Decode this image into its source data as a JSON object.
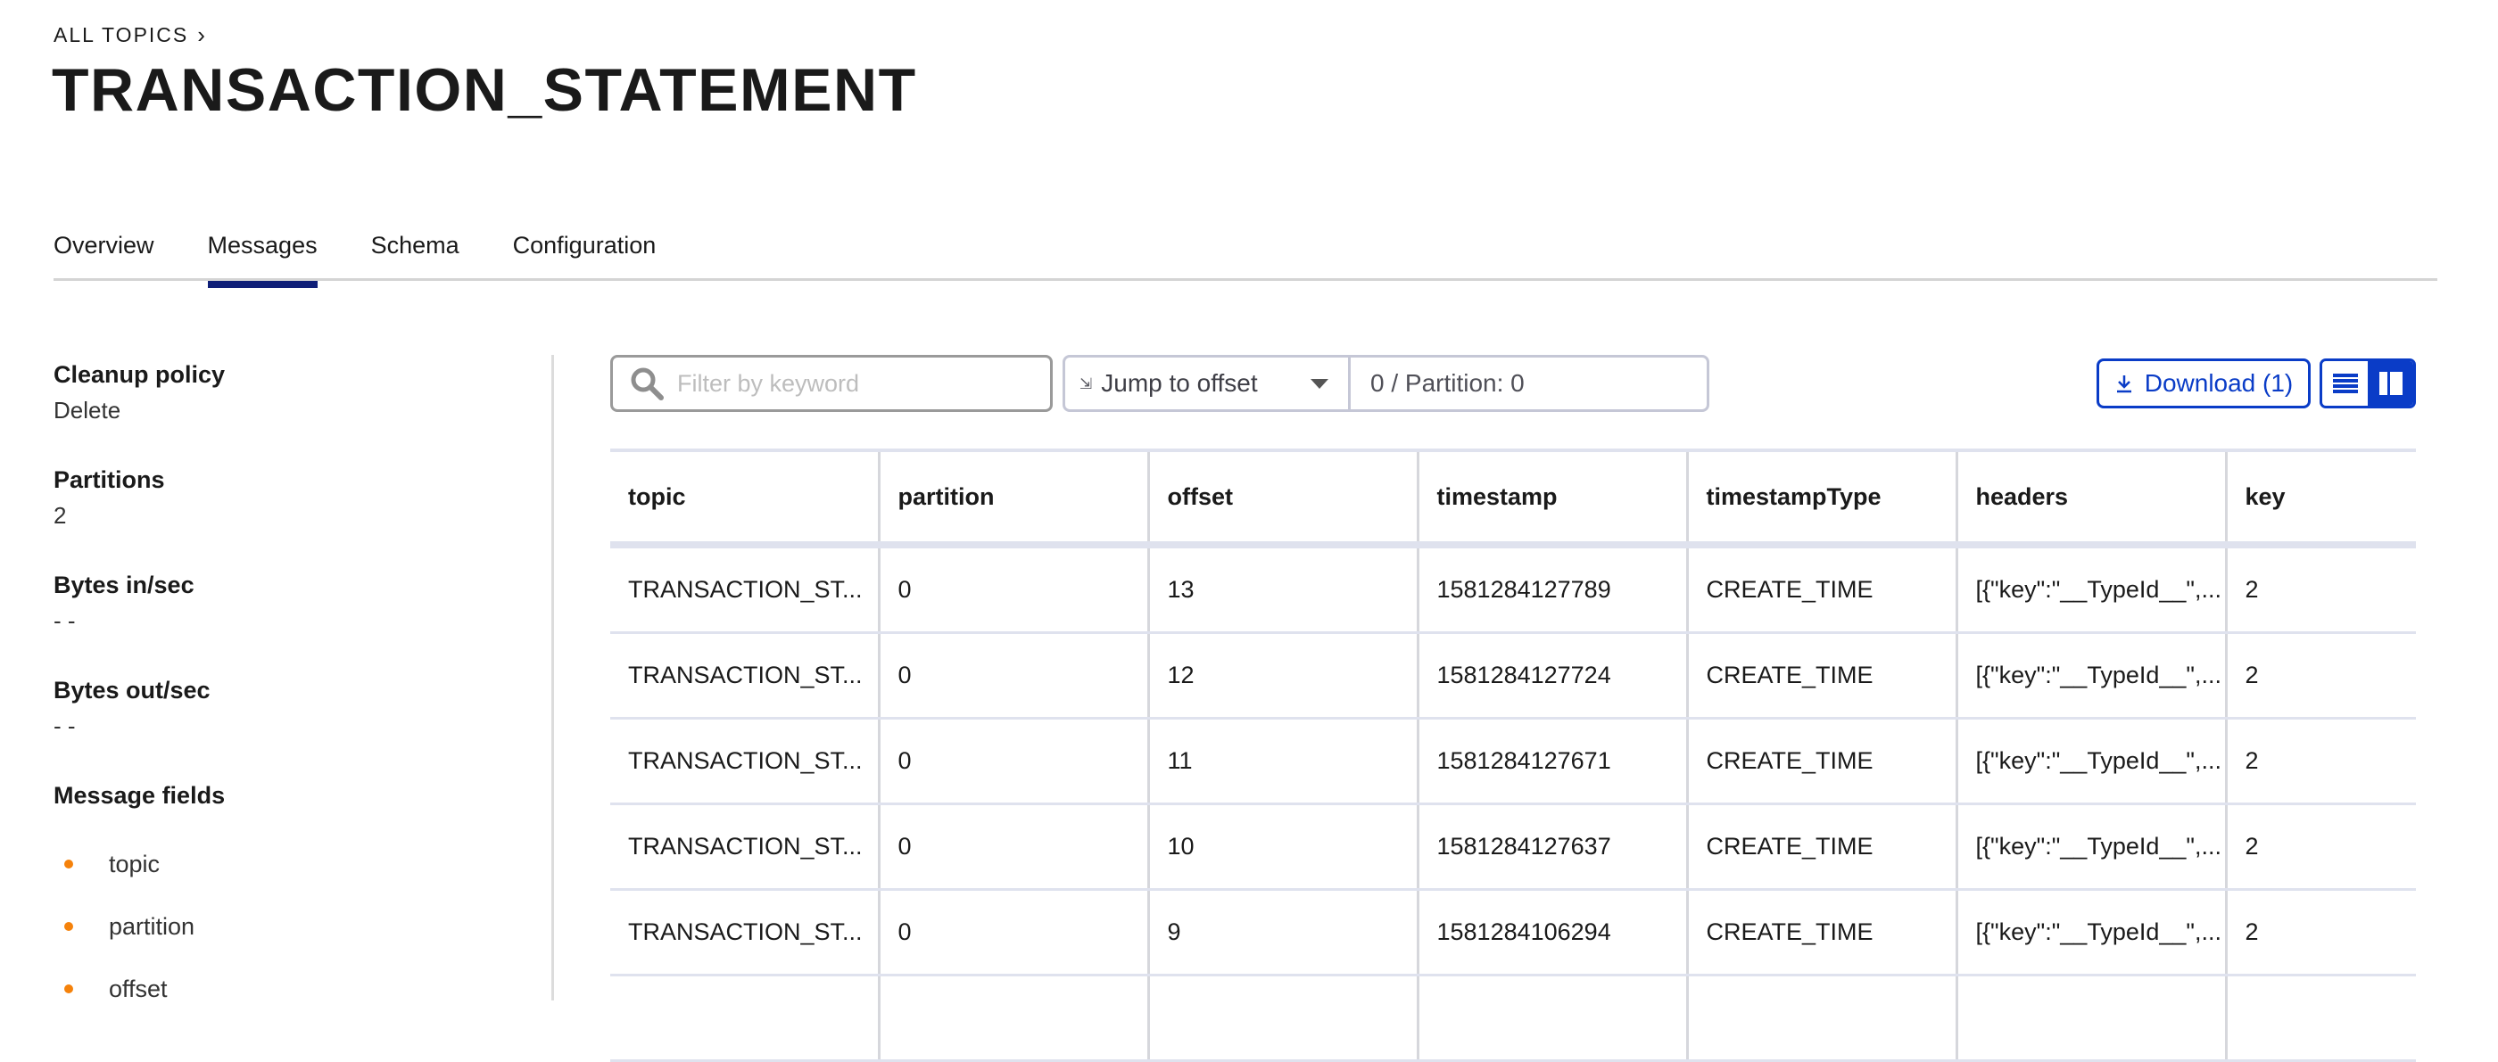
{
  "breadcrumb": {
    "label": "ALL TOPICS",
    "chevron": "›"
  },
  "page": {
    "title": "TRANSACTION_STATEMENT"
  },
  "tabs": [
    {
      "label": "Overview",
      "active": false
    },
    {
      "label": "Messages",
      "active": true
    },
    {
      "label": "Schema",
      "active": false
    },
    {
      "label": "Configuration",
      "active": false
    }
  ],
  "sidebar": {
    "cleanup_policy": {
      "label": "Cleanup policy",
      "value": "Delete"
    },
    "partitions": {
      "label": "Partitions",
      "value": "2"
    },
    "bytes_in": {
      "label": "Bytes in/sec",
      "value": "- -"
    },
    "bytes_out": {
      "label": "Bytes out/sec",
      "value": "- -"
    },
    "message_fields": {
      "label": "Message fields",
      "items": [
        "topic",
        "partition",
        "offset"
      ]
    }
  },
  "toolbar": {
    "search": {
      "placeholder": "Filter by keyword",
      "value": "",
      "icon": "search-icon"
    },
    "jump": {
      "mode_label": "Jump to offset",
      "icon": "jump-offset-icon",
      "value": "0 / Partition: 0"
    },
    "download_label": "Download (1)",
    "download_icon": "download-icon",
    "view_modes": [
      {
        "name": "list-view",
        "icon": "list-icon",
        "active": false
      },
      {
        "name": "card-view",
        "icon": "split-view-icon",
        "active": true
      }
    ]
  },
  "table": {
    "columns": [
      "topic",
      "partition",
      "offset",
      "timestamp",
      "timestampType",
      "headers",
      "key"
    ],
    "rows": [
      [
        "TRANSACTION_ST...",
        "0",
        "13",
        "1581284127789",
        "CREATE_TIME",
        "[{\"key\":\"__TypeId__\",...",
        "2"
      ],
      [
        "TRANSACTION_ST...",
        "0",
        "12",
        "1581284127724",
        "CREATE_TIME",
        "[{\"key\":\"__TypeId__\",...",
        "2"
      ],
      [
        "TRANSACTION_ST...",
        "0",
        "11",
        "1581284127671",
        "CREATE_TIME",
        "[{\"key\":\"__TypeId__\",...",
        "2"
      ],
      [
        "TRANSACTION_ST...",
        "0",
        "10",
        "1581284127637",
        "CREATE_TIME",
        "[{\"key\":\"__TypeId__\",...",
        "2"
      ],
      [
        "TRANSACTION_ST...",
        "0",
        "9",
        "1581284106294",
        "CREATE_TIME",
        "[{\"key\":\"__TypeId__\",...",
        "2"
      ],
      [
        "",
        "",
        "",
        "",
        "",
        "",
        ""
      ]
    ]
  },
  "colors": {
    "accent": "#0a3cc7",
    "tab_indicator": "#0f1f78",
    "bullet": "#f5820b"
  }
}
